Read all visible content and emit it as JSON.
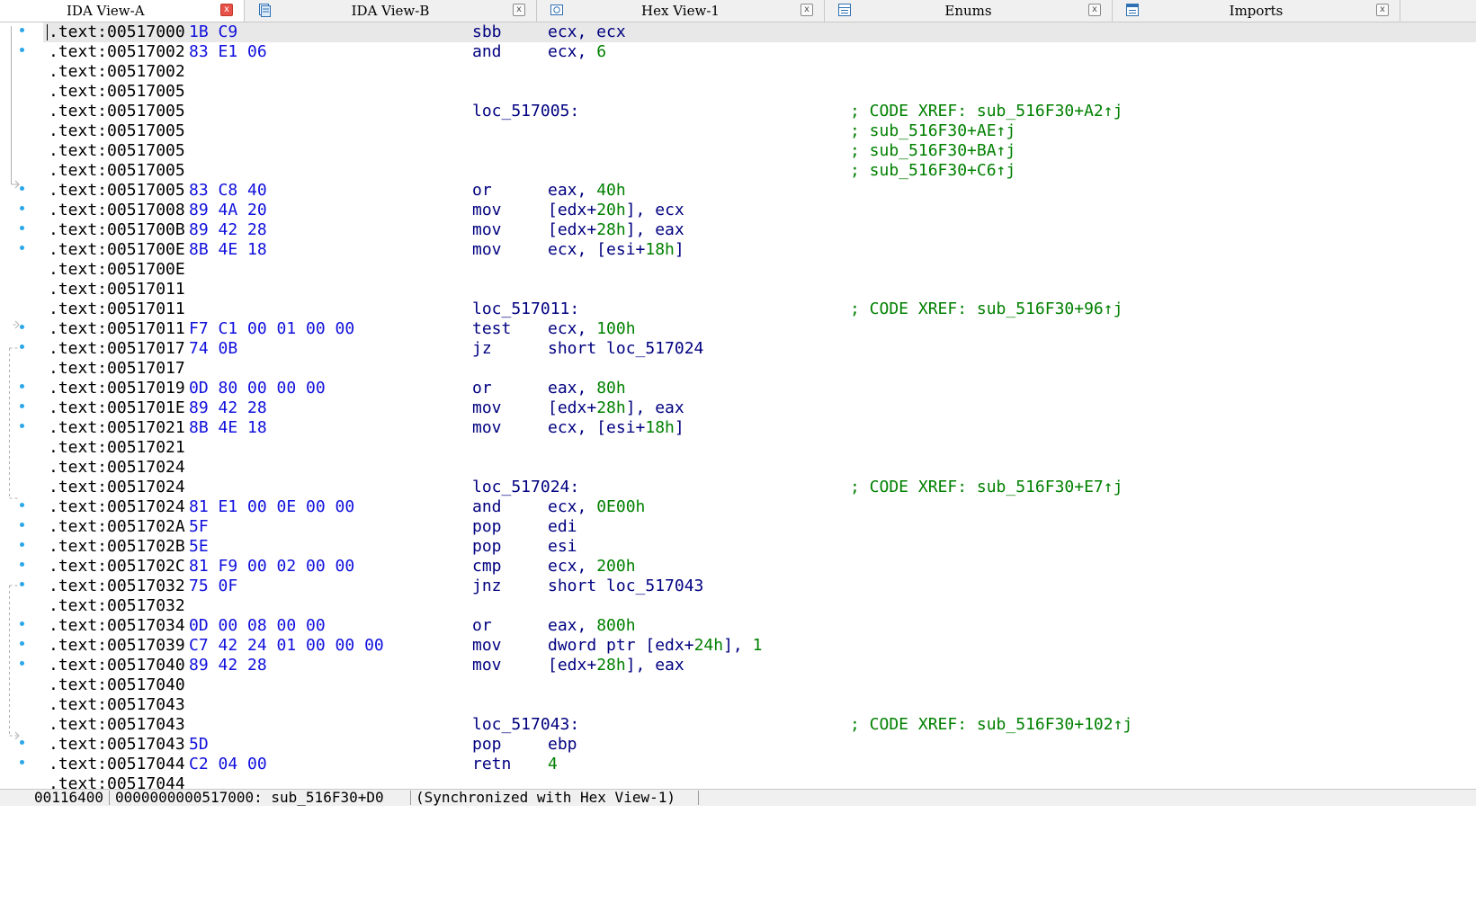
{
  "tabs": [
    {
      "label": "IDA View-A",
      "active": true,
      "icon": "none"
    },
    {
      "label": "IDA View-B",
      "active": false,
      "icon": "document-icon"
    },
    {
      "label": "Hex View-1",
      "active": false,
      "icon": "hex-icon"
    },
    {
      "label": "Enums",
      "active": false,
      "icon": "enums-icon"
    },
    {
      "label": "Imports",
      "active": false,
      "icon": "imports-icon"
    }
  ],
  "close_glyph": "x",
  "colors": {
    "address": "#000000",
    "bytes": "#1010dd",
    "instruction": "#000080",
    "number": "#008000",
    "comment": "#008000",
    "marker": "#2aa7e8"
  },
  "lines": [
    {
      "addr": ".text:00517000",
      "bytes": "1B C9",
      "mnem": "sbb",
      "ops": [
        {
          "t": "ecx, ecx"
        }
      ],
      "current": true,
      "dot": true
    },
    {
      "addr": ".text:00517002",
      "bytes": "83 E1 06",
      "mnem": "and",
      "ops": [
        {
          "t": "ecx, "
        },
        {
          "t": "6",
          "n": 1
        }
      ],
      "dot": true
    },
    {
      "addr": ".text:00517002"
    },
    {
      "addr": ".text:00517005"
    },
    {
      "addr": ".text:00517005",
      "label": "loc_517005:",
      "comment": "; CODE XREF: sub_516F30+A2↑j"
    },
    {
      "addr": ".text:00517005",
      "comment": "; sub_516F30+AE↑j"
    },
    {
      "addr": ".text:00517005",
      "comment": "; sub_516F30+BA↑j"
    },
    {
      "addr": ".text:00517005",
      "comment": "; sub_516F30+C6↑j"
    },
    {
      "addr": ".text:00517005",
      "bytes": "83 C8 40",
      "mnem": "or",
      "ops": [
        {
          "t": "eax, "
        },
        {
          "t": "40h",
          "n": 1
        }
      ],
      "dot": true,
      "target": true
    },
    {
      "addr": ".text:00517008",
      "bytes": "89 4A 20",
      "mnem": "mov",
      "ops": [
        {
          "t": "["
        },
        {
          "t": "edx+"
        },
        {
          "t": "20h",
          "n": 1
        },
        {
          "t": "], ecx"
        }
      ],
      "dot": true
    },
    {
      "addr": ".text:0051700B",
      "bytes": "89 42 28",
      "mnem": "mov",
      "ops": [
        {
          "t": "[edx+"
        },
        {
          "t": "28h",
          "n": 1
        },
        {
          "t": "], eax"
        }
      ],
      "dot": true
    },
    {
      "addr": ".text:0051700E",
      "bytes": "8B 4E 18",
      "mnem": "mov",
      "ops": [
        {
          "t": "ecx, [esi+"
        },
        {
          "t": "18h",
          "n": 1
        },
        {
          "t": "]"
        }
      ],
      "dot": true
    },
    {
      "addr": ".text:0051700E"
    },
    {
      "addr": ".text:00517011"
    },
    {
      "addr": ".text:00517011",
      "label": "loc_517011:",
      "comment": "; CODE XREF: sub_516F30+96↑j"
    },
    {
      "addr": ".text:00517011",
      "bytes": "F7 C1 00 01 00 00",
      "mnem": "test",
      "ops": [
        {
          "t": "ecx, "
        },
        {
          "t": "100h",
          "n": 1
        }
      ],
      "dot": true,
      "target": true
    },
    {
      "addr": ".text:00517017",
      "bytes": "74 0B",
      "mnem": "jz",
      "ops": [
        {
          "t": "short loc_517024"
        }
      ],
      "dot": true
    },
    {
      "addr": ".text:00517017"
    },
    {
      "addr": ".text:00517019",
      "bytes": "0D 80 00 00 00",
      "mnem": "or",
      "ops": [
        {
          "t": "eax, "
        },
        {
          "t": "80h",
          "n": 1
        }
      ],
      "dot": true
    },
    {
      "addr": ".text:0051701E",
      "bytes": "89 42 28",
      "mnem": "mov",
      "ops": [
        {
          "t": "[edx+"
        },
        {
          "t": "28h",
          "n": 1
        },
        {
          "t": "], eax"
        }
      ],
      "dot": true
    },
    {
      "addr": ".text:00517021",
      "bytes": "8B 4E 18",
      "mnem": "mov",
      "ops": [
        {
          "t": "ecx, [esi+"
        },
        {
          "t": "18h",
          "n": 1
        },
        {
          "t": "]"
        }
      ],
      "dot": true
    },
    {
      "addr": ".text:00517021"
    },
    {
      "addr": ".text:00517024"
    },
    {
      "addr": ".text:00517024",
      "label": "loc_517024:",
      "comment": "; CODE XREF: sub_516F30+E7↑j"
    },
    {
      "addr": ".text:00517024",
      "bytes": "81 E1 00 0E 00 00",
      "mnem": "and",
      "ops": [
        {
          "t": "ecx, "
        },
        {
          "t": "0E00h",
          "n": 1
        }
      ],
      "dot": true,
      "target": true
    },
    {
      "addr": ".text:0051702A",
      "bytes": "5F",
      "mnem": "pop",
      "ops": [
        {
          "t": "edi"
        }
      ],
      "dot": true
    },
    {
      "addr": ".text:0051702B",
      "bytes": "5E",
      "mnem": "pop",
      "ops": [
        {
          "t": "esi"
        }
      ],
      "dot": true
    },
    {
      "addr": ".text:0051702C",
      "bytes": "81 F9 00 02 00 00",
      "mnem": "cmp",
      "ops": [
        {
          "t": "ecx, "
        },
        {
          "t": "200h",
          "n": 1
        }
      ],
      "dot": true
    },
    {
      "addr": ".text:00517032",
      "bytes": "75 0F",
      "mnem": "jnz",
      "ops": [
        {
          "t": "short loc_517043"
        }
      ],
      "dot": true
    },
    {
      "addr": ".text:00517032"
    },
    {
      "addr": ".text:00517034",
      "bytes": "0D 00 08 00 00",
      "mnem": "or",
      "ops": [
        {
          "t": "eax, "
        },
        {
          "t": "800h",
          "n": 1
        }
      ],
      "dot": true
    },
    {
      "addr": ".text:00517039",
      "bytes": "C7 42 24 01 00 00 00",
      "mnem": "mov",
      "ops": [
        {
          "t": "dword ptr [edx+"
        },
        {
          "t": "24h",
          "n": 1
        },
        {
          "t": "], "
        },
        {
          "t": "1",
          "n": 1
        }
      ],
      "dot": true
    },
    {
      "addr": ".text:00517040",
      "bytes": "89 42 28",
      "mnem": "mov",
      "ops": [
        {
          "t": "[edx+"
        },
        {
          "t": "28h",
          "n": 1
        },
        {
          "t": "], eax"
        }
      ],
      "dot": true
    },
    {
      "addr": ".text:00517040"
    },
    {
      "addr": ".text:00517043"
    },
    {
      "addr": ".text:00517043",
      "label": "loc_517043:",
      "comment": "; CODE XREF: sub_516F30+102↑j"
    },
    {
      "addr": ".text:00517043",
      "bytes": "5D",
      "mnem": "pop",
      "ops": [
        {
          "t": "ebp"
        }
      ],
      "dot": true,
      "target": true
    },
    {
      "addr": ".text:00517044",
      "bytes": "C2 04 00",
      "mnem": "retn",
      "ops": [
        {
          "t": "4",
          "n": 1
        }
      ],
      "dot": true
    },
    {
      "addr": ".text:00517044"
    }
  ],
  "status": {
    "offset": "00116400",
    "location": "0000000000517000: sub_516F30+D0",
    "sync": "(Synchronized with Hex View-1)"
  }
}
